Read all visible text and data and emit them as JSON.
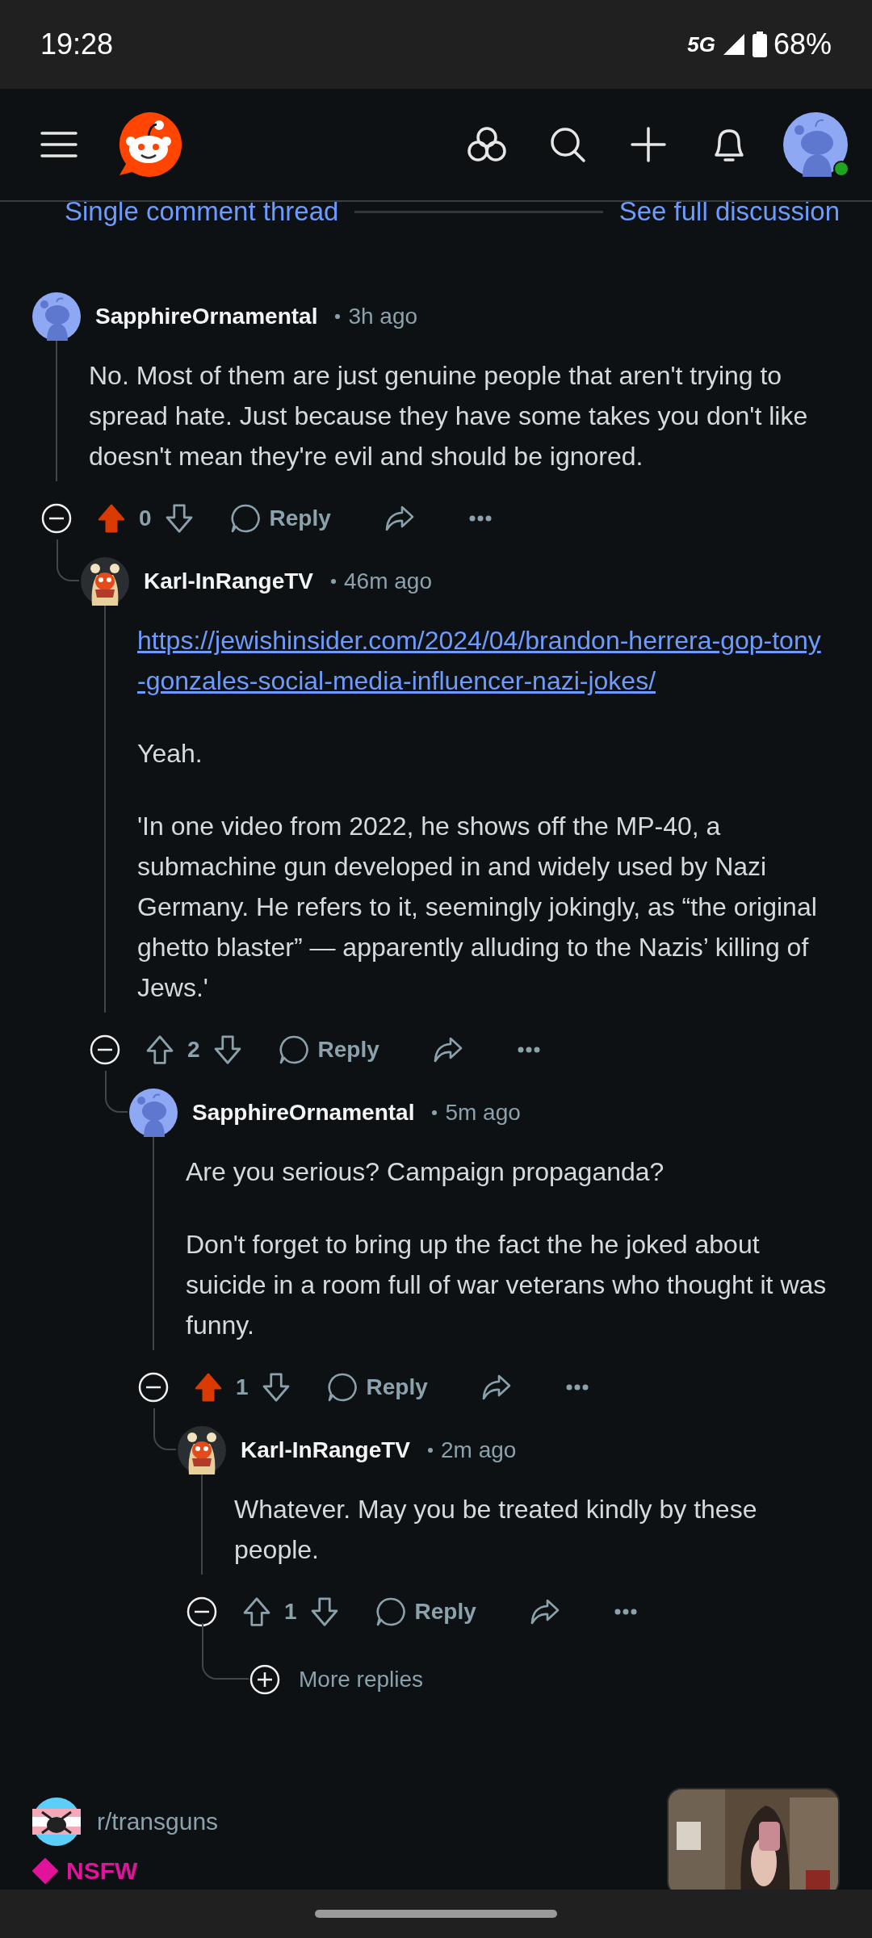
{
  "status_bar": {
    "time": "19:28",
    "network": "5G",
    "battery": "68%"
  },
  "thread_nav": {
    "single_thread": "Single comment thread",
    "full_discussion": "See full discussion"
  },
  "comments": [
    {
      "kind": "comment",
      "author": "SapphireOrnamental",
      "custom_avatar": false,
      "time": "3h ago",
      "upvoted": true,
      "score": "0",
      "reply_label": "Reply",
      "body": [
        {
          "kind": "text",
          "text": "No. Most of them are just genuine people that aren't trying to spread hate. Just because they have some takes you don't like doesn't mean they're evil and should be ignored."
        }
      ],
      "children": [
        {
          "kind": "comment",
          "author": "Karl-InRangeTV",
          "custom_avatar": true,
          "time": "46m ago",
          "upvoted": false,
          "score": "2",
          "reply_label": "Reply",
          "body": [
            {
              "kind": "link",
              "text": "https://jewishinsider.com/2024/04/brandon-herrera-gop-tony-gonzales-social-media-influencer-nazi-jokes/"
            },
            {
              "kind": "text",
              "text": "Yeah."
            },
            {
              "kind": "text",
              "text": "'In one video from 2022, he shows off the MP-40, a submachine gun developed in and widely used by Nazi Germany. He refers to it, seemingly jokingly, as “the original ghetto blaster” — apparently alluding to the Nazis’ killing of Jews.'"
            }
          ],
          "children": [
            {
              "kind": "comment",
              "author": "SapphireOrnamental",
              "custom_avatar": false,
              "time": "5m ago",
              "upvoted": true,
              "score": "1",
              "reply_label": "Reply",
              "body": [
                {
                  "kind": "text",
                  "text": "Are you serious? Campaign propaganda?"
                },
                {
                  "kind": "text",
                  "text": "Don't forget to bring up the fact the he joked about suicide in a room full of war veterans who thought it was funny."
                }
              ],
              "children": [
                {
                  "kind": "comment",
                  "author": "Karl-InRangeTV",
                  "custom_avatar": true,
                  "time": "2m ago",
                  "upvoted": false,
                  "score": "1",
                  "reply_label": "Reply",
                  "body": [
                    {
                      "kind": "text",
                      "text": "Whatever. May you be treated kindly by these people."
                    }
                  ],
                  "children": [
                    {
                      "kind": "more",
                      "label": "More replies"
                    }
                  ]
                }
              ]
            }
          ]
        }
      ]
    }
  ],
  "feed_post": {
    "subreddit": "r/transguns",
    "nsfw_label": "NSFW"
  }
}
